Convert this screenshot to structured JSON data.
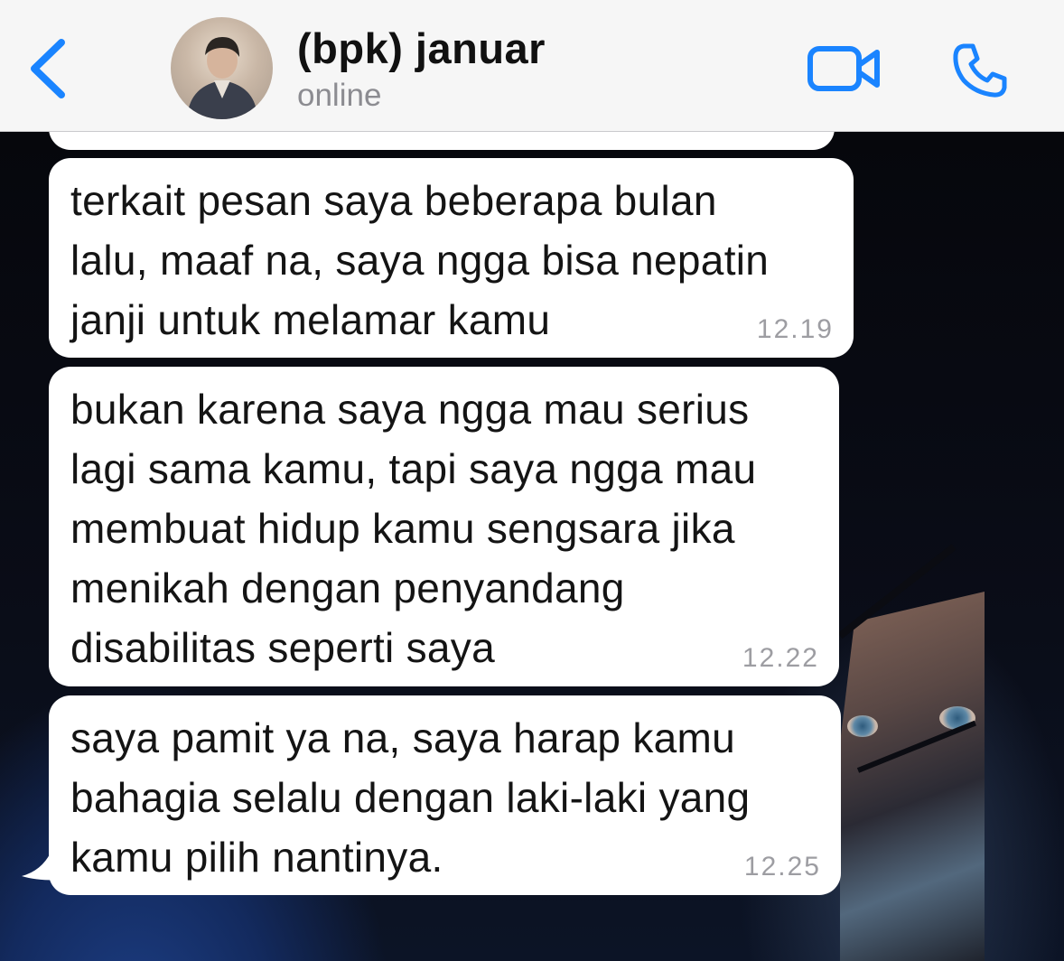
{
  "header": {
    "back_icon": "chevron-left-icon",
    "contact_name": "(bpk) januar",
    "status": "online",
    "video_icon": "video-camera-icon",
    "call_icon": "phone-icon",
    "accent_color": "#1a84ff"
  },
  "messages": [
    {
      "text": "terkait pesan saya beberapa bulan\nlalu, maaf na, saya ngga bisa nepatin\njanji untuk melamar kamu",
      "time": "12.19",
      "direction": "incoming"
    },
    {
      "text": "bukan karena saya ngga mau serius\nlagi sama kamu, tapi saya ngga mau\nmembuat hidup kamu sengsara jika\nmenikah dengan penyandang\ndisabilitas seperti saya",
      "time": "12.22",
      "direction": "incoming"
    },
    {
      "text": "saya pamit ya na, saya harap kamu\nbahagia selalu dengan laki-laki yang\nkamu pilih nantinya.",
      "time": "12.25",
      "direction": "incoming"
    }
  ]
}
